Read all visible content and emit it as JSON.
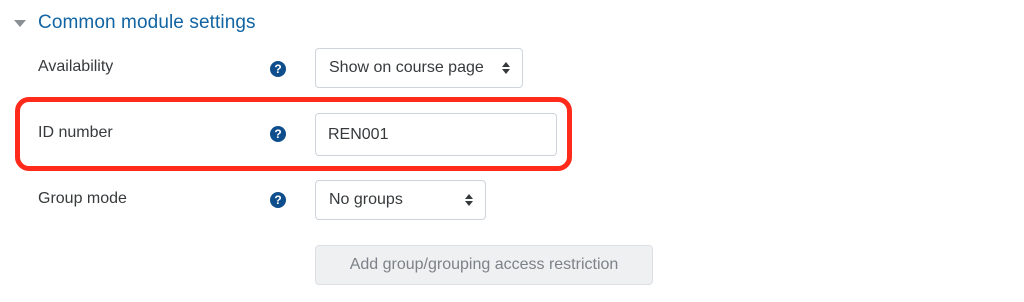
{
  "section": {
    "title": "Common module settings"
  },
  "fields": {
    "availability": {
      "label": "Availability",
      "value": "Show on course page"
    },
    "id_number": {
      "label": "ID number",
      "value": "REN001"
    },
    "group_mode": {
      "label": "Group mode",
      "value": "No groups"
    }
  },
  "help_icon": "question-circle-icon",
  "restriction_button": {
    "label": "Add group/grouping access restriction"
  },
  "colors": {
    "section_title": "#1264a3",
    "help_icon": "#0f4e8c",
    "highlight": "#ff2a1a"
  }
}
